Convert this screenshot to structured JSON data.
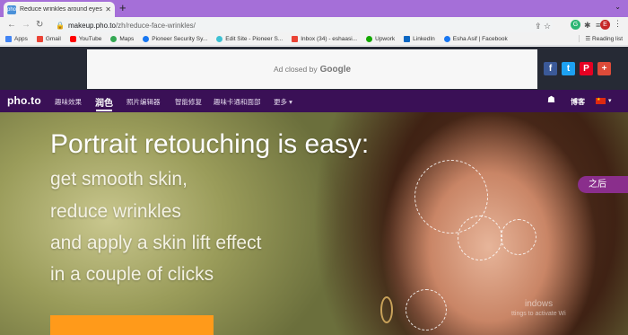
{
  "browser": {
    "tab_title": "Reduce wrinkles around eyes and...",
    "tab_favicon": "pho to",
    "new_tab": "+",
    "url_domain": "makeup.pho.to",
    "url_path": "/zh/reduce-face-wrinkles/",
    "profile_initial": "E",
    "extension_letter": "G"
  },
  "bookmarks": {
    "items": [
      "Apps",
      "Gmail",
      "YouTube",
      "Maps",
      "Pioneer Security Sy...",
      "Edit Site - Pioneer S...",
      "Inbox (34) - eshaasi...",
      "Upwork",
      "LinkedIn",
      "Esha Asif | Facebook"
    ],
    "reading_list": "Reading list"
  },
  "ad": {
    "text": "Ad closed by",
    "brand": "Google"
  },
  "site": {
    "logo": "pho.to",
    "nav": [
      "趣味效果",
      "润色",
      "照片编辑器",
      "智能修复",
      "趣味卡通和面部",
      "更多 ▾"
    ],
    "blog": "博客"
  },
  "hero": {
    "title": "Portrait retouching is easy:",
    "lines": [
      "get smooth skin,",
      "reduce wrinkles",
      "and apply a skin lift effect",
      "in a couple of clicks"
    ],
    "after_button": "之后"
  },
  "watermark": {
    "line1": "indows",
    "line2": "ttings to activate Wi"
  },
  "colors": {
    "tabstrip": "#a56fd8",
    "site_nav": "#3a1056",
    "cta": "#ff9a1a",
    "after_button": "#8a2e8c"
  }
}
